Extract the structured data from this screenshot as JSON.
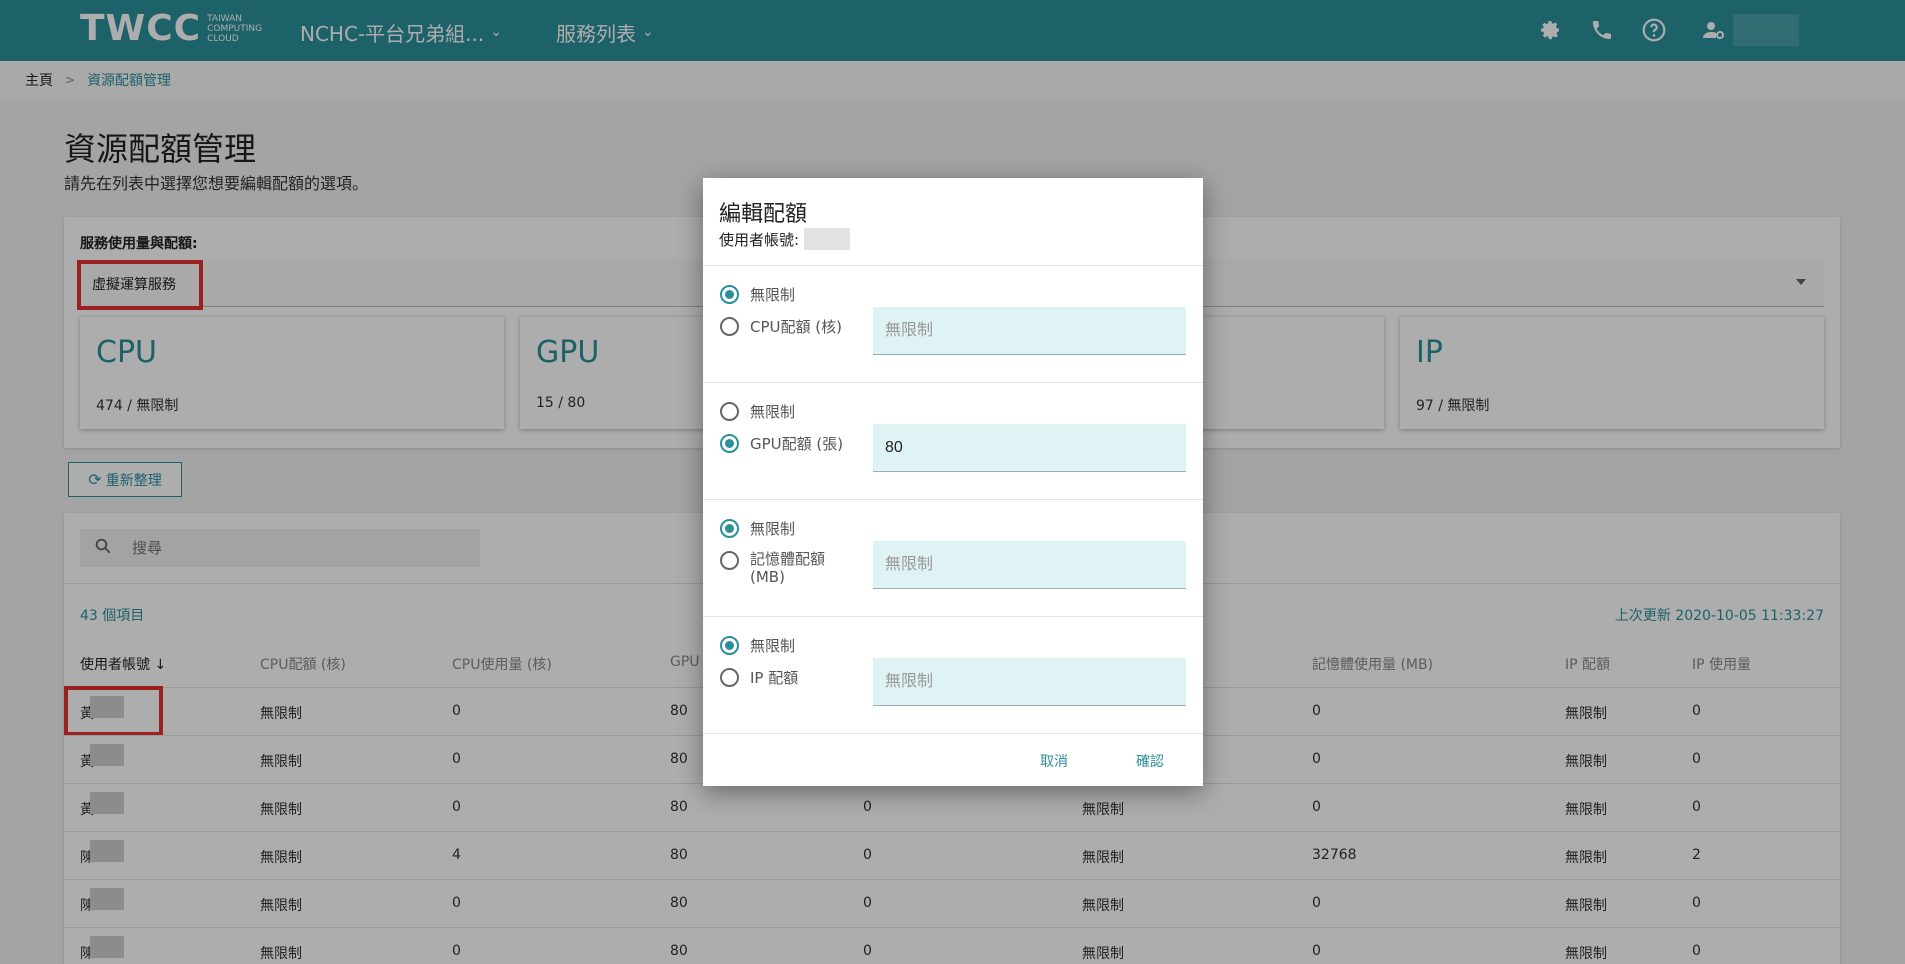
{
  "header": {
    "logo_text": "TWCC",
    "logo_sub": "TAIWAN COMPUTING CLOUD",
    "project_menu": "NCHC-平台兄弟組...",
    "service_menu": "服務列表"
  },
  "breadcrumb": {
    "home": "主頁",
    "separator": ">",
    "current": "資源配額管理"
  },
  "page": {
    "title": "資源配額管理",
    "subtitle": "請先在列表中選擇您想要編輯配額的選項。"
  },
  "service": {
    "label": "服務使用量與配額:",
    "selected": "虛擬運算服務",
    "stats": [
      {
        "name": "CPU",
        "value": "474 / 無限制"
      },
      {
        "name": "GPU",
        "value": "15 / 80"
      },
      {
        "name": "IP",
        "value": "97 / 無限制"
      }
    ]
  },
  "refresh_label": "重新整理",
  "table": {
    "search_placeholder": "搜尋",
    "count": "43 個項目",
    "updated": "上次更新 2020-10-05 11:33:27",
    "headers": [
      "使用者帳號 ↓",
      "CPU配額 (核)",
      "CPU使用量 (核)",
      "GPU",
      "記憶體使用量 (MB)",
      "IP 配額",
      "IP 使用量"
    ],
    "rows": [
      {
        "prefix": "黃",
        "cpu_q": "無限制",
        "cpu_u": "0",
        "gpu_q": "80",
        "gpu_u": "",
        "mem_q": "",
        "mem_u": "0",
        "ip_q": "無限制",
        "ip_u": "0"
      },
      {
        "prefix": "黃",
        "cpu_q": "無限制",
        "cpu_u": "0",
        "gpu_q": "80",
        "gpu_u": "",
        "mem_q": "",
        "mem_u": "0",
        "ip_q": "無限制",
        "ip_u": "0"
      },
      {
        "prefix": "黃",
        "cpu_q": "無限制",
        "cpu_u": "0",
        "gpu_q": "80",
        "gpu_u": "0",
        "mem_q": "無限制",
        "mem_u": "0",
        "ip_q": "無限制",
        "ip_u": "0"
      },
      {
        "prefix": "陳",
        "cpu_q": "無限制",
        "cpu_u": "4",
        "gpu_q": "80",
        "gpu_u": "0",
        "mem_q": "無限制",
        "mem_u": "32768",
        "ip_q": "無限制",
        "ip_u": "2"
      },
      {
        "prefix": "陳",
        "cpu_q": "無限制",
        "cpu_u": "0",
        "gpu_q": "80",
        "gpu_u": "0",
        "mem_q": "無限制",
        "mem_u": "0",
        "ip_q": "無限制",
        "ip_u": "0"
      },
      {
        "prefix": "陳",
        "cpu_q": "無限制",
        "cpu_u": "0",
        "gpu_q": "80",
        "gpu_u": "0",
        "mem_q": "無限制",
        "mem_u": "0",
        "ip_q": "無限制",
        "ip_u": "0"
      }
    ]
  },
  "dialog": {
    "title": "編輯配額",
    "subtitle": "使用者帳號:",
    "sections": [
      {
        "unlimited": "無限制",
        "label": "CPU配額 (核)",
        "value": "",
        "placeholder": "無限制"
      },
      {
        "unlimited": "無限制",
        "label": "GPU配額 (張)",
        "value": "80",
        "placeholder": ""
      },
      {
        "unlimited": "無限制",
        "label": "記憶體配額 (MB)",
        "value": "",
        "placeholder": "無限制"
      },
      {
        "unlimited": "無限制",
        "label": "IP 配額",
        "value": "",
        "placeholder": "無限制"
      }
    ],
    "cancel": "取消",
    "confirm": "確認"
  },
  "colors": {
    "accent": "#2b8f9b",
    "highlight": "#e53030"
  }
}
